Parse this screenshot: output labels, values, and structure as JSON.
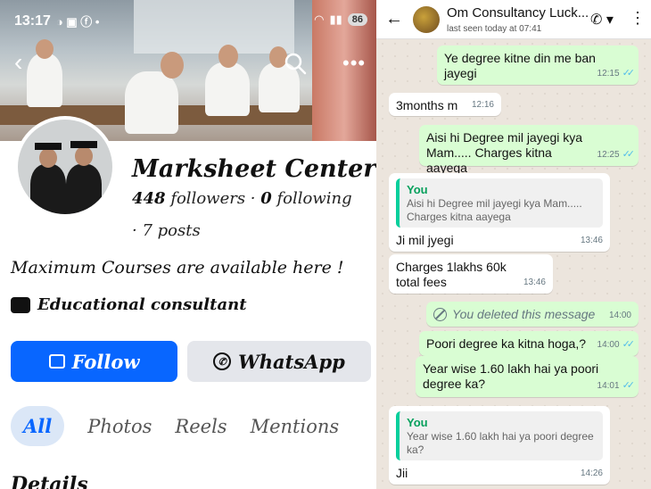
{
  "statusbar": {
    "time": "13:17",
    "battery": "86"
  },
  "profile": {
    "name": "Marksheet Center",
    "followers": "448",
    "followers_label": "followers",
    "following": "0",
    "following_label": "following",
    "posts": "· 7 posts",
    "bio": "Maximum Courses are available here !",
    "category": "Educational consultant",
    "follow_label": "Follow",
    "whatsapp_label": "WhatsApp",
    "tabs": [
      "All",
      "Photos",
      "Reels",
      "Mentions"
    ],
    "details_heading": "Details"
  },
  "chat": {
    "contact_name": "Om Consultancy Luck...",
    "last_seen": "last seen today at 07:41",
    "messages": [
      {
        "dir": "out",
        "text": "Ye degree kitne din me ban jayegi",
        "time": "12:15",
        "read": true
      },
      {
        "dir": "in",
        "text": "3months m",
        "time": "12:16"
      },
      {
        "dir": "out",
        "text": "Aisi hi Degree mil jayegi kya Mam..... Charges kitna aayega",
        "time": "12:25",
        "read": true
      },
      {
        "dir": "in",
        "quote_name": "You",
        "quote_text": "Aisi hi Degree mil jayegi kya Mam..... Charges kitna aayega",
        "text": "Ji mil jyegi",
        "time": "13:46"
      },
      {
        "dir": "in",
        "text": "Charges 1lakhs 60k total fees",
        "time": "13:46"
      },
      {
        "dir": "out",
        "deleted": true,
        "text": "You deleted this message",
        "time": "14:00"
      },
      {
        "dir": "out",
        "text": "Poori degree ka kitna hoga,?",
        "time": "14:00",
        "read": true
      },
      {
        "dir": "out",
        "text": "Year wise 1.60 lakh hai ya poori degree ka?",
        "time": "14:01",
        "read": true
      },
      {
        "dir": "in",
        "quote_name": "You",
        "quote_text": "Year wise 1.60 lakh hai ya poori degree ka?",
        "text": "Jii",
        "time": "14:26"
      }
    ]
  }
}
